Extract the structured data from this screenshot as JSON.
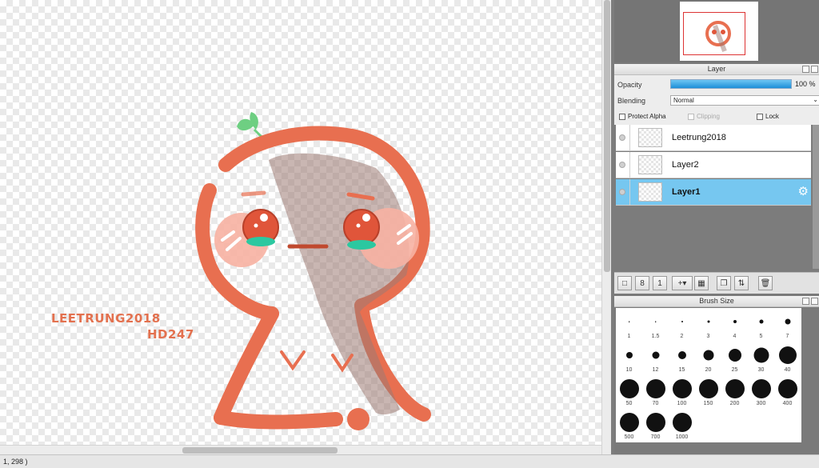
{
  "status": {
    "coords": "1, 298 )"
  },
  "canvas": {
    "watermark_line1": "Leetrung2018",
    "watermark_line2": "HD247",
    "art_colors": {
      "stroke": "#e86f50",
      "leaf": "#6ecf82",
      "blush": "#f7b1a2",
      "teal": "#2bc8a0",
      "shadow": "#9c7a72"
    }
  },
  "layer_panel": {
    "title": "Layer",
    "opacity_label": "Opacity",
    "opacity_value": "100 %",
    "opacity_fraction": 1.0,
    "blending_label": "Blending",
    "blending_value": "Normal",
    "protect_alpha_label": "Protect Alpha",
    "clipping_label": "Clipping",
    "lock_label": "Lock",
    "layers": [
      {
        "name": "Leetrung2018",
        "selected": false
      },
      {
        "name": "Layer2",
        "selected": false
      },
      {
        "name": "Layer1",
        "selected": true
      }
    ],
    "toolbar_icons": [
      "new-layer-icon",
      "new-8bit-layer-icon",
      "new-1bit-layer-icon",
      "add-layer-menu-icon",
      "folder-icon",
      "duplicate-layer-icon",
      "merge-layer-icon",
      "delete-layer-icon"
    ]
  },
  "brush_panel": {
    "title": "Brush Size",
    "sizes": [
      "1",
      "1.5",
      "2",
      "3",
      "4",
      "5",
      "7",
      "10",
      "12",
      "15",
      "20",
      "25",
      "30",
      "40",
      "50",
      "70",
      "100",
      "150",
      "200",
      "300",
      "400",
      "500",
      "700",
      "1000"
    ]
  }
}
